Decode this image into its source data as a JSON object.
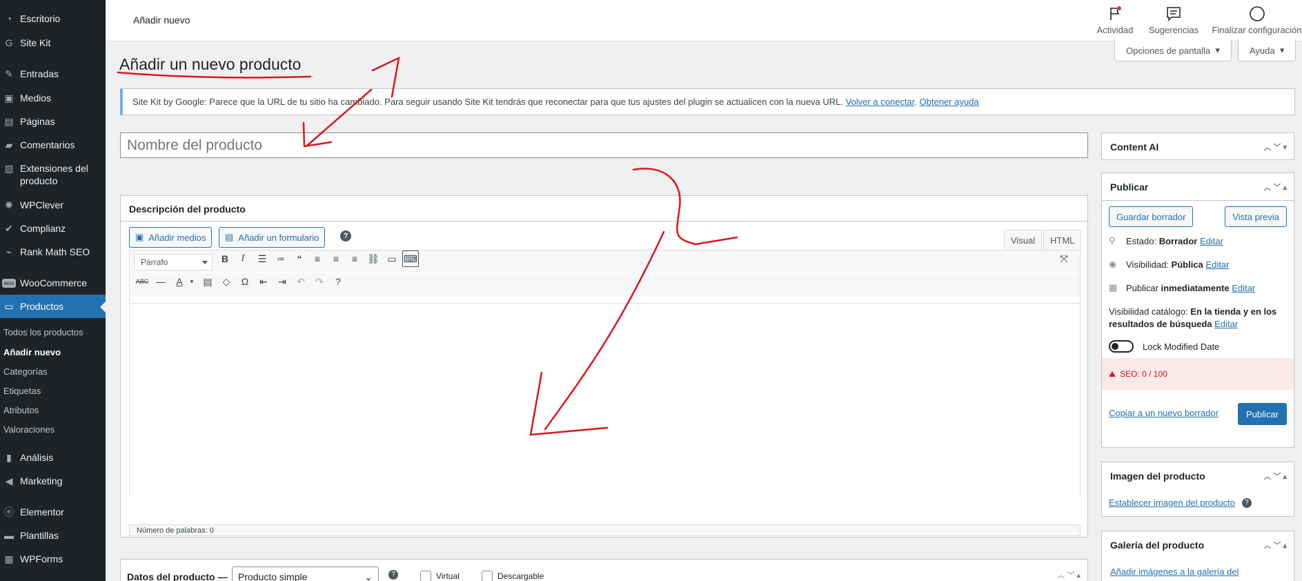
{
  "sidebar": {
    "items": [
      {
        "label": "Escritorio",
        "icon": "dashboard-icon"
      },
      {
        "label": "Site Kit",
        "icon": "sitekit-icon"
      },
      {
        "label": "Entradas",
        "icon": "pin-icon"
      },
      {
        "label": "Medios",
        "icon": "media-icon"
      },
      {
        "label": "Páginas",
        "icon": "page-icon"
      },
      {
        "label": "Comentarios",
        "icon": "comment-icon"
      },
      {
        "label": "Extensiones del producto",
        "icon": "extension-icon"
      },
      {
        "label": "WPClever",
        "icon": "bulb-icon"
      },
      {
        "label": "Complianz",
        "icon": "check-icon"
      },
      {
        "label": "Rank Math SEO",
        "icon": "chart-icon"
      },
      {
        "label": "WooCommerce",
        "icon": "woo-icon"
      },
      {
        "label": "Productos",
        "icon": "archive-icon"
      },
      {
        "label": "Análisis",
        "icon": "bar-chart-icon"
      },
      {
        "label": "Marketing",
        "icon": "megaphone-icon"
      },
      {
        "label": "Elementor",
        "icon": "elementor-icon"
      },
      {
        "label": "Plantillas",
        "icon": "folder-icon"
      },
      {
        "label": "WPForms",
        "icon": "forms-icon"
      }
    ],
    "subitems": [
      {
        "label": "Todos los productos"
      },
      {
        "label": "Añadir nuevo"
      },
      {
        "label": "Categorías"
      },
      {
        "label": "Etiquetas"
      },
      {
        "label": "Atributos"
      },
      {
        "label": "Valoraciones"
      }
    ]
  },
  "topbar": {
    "breadcrumb": "Añadir nuevo",
    "actions": [
      {
        "label": "Actividad",
        "icon": "flag-icon"
      },
      {
        "label": "Sugerencias",
        "icon": "message-icon"
      },
      {
        "label": "Finalizar configuración",
        "icon": "circle-icon"
      }
    ],
    "screen_options": "Opciones de pantalla",
    "help": "Ayuda"
  },
  "page": {
    "title": "Añadir un nuevo producto",
    "notice_text": "Site Kit by Google: Parece que la URL de tu sitio ha cambiado. Para seguir usando Site Kit tendrás que reconectar para que tus ajustes del plugin se actualicen con la nueva URL.",
    "notice_link1": "Volver a conectar",
    "notice_sep": ".",
    "notice_link2": "Obtener ayuda",
    "title_placeholder": "Nombre del producto"
  },
  "editor": {
    "header": "Descripción del producto",
    "add_media": "Añadir medios",
    "add_form": "Añadir un formulario",
    "tab_visual": "Visual",
    "tab_html": "HTML",
    "format": "Párrafo",
    "word_count": "Número de palabras: 0"
  },
  "product_data": {
    "title": "Datos del producto —",
    "type": "Producto simple",
    "virtual": "Virtual",
    "downloadable": "Descargable"
  },
  "content_ai": {
    "title": "Content AI"
  },
  "publish": {
    "title": "Publicar",
    "save_draft": "Guardar borrador",
    "preview": "Vista previa",
    "status_label": "Estado: ",
    "status_value": "Borrador",
    "edit": "Editar",
    "visibility_label": "Visibilidad: ",
    "visibility_value": "Pública",
    "publish_label": "Publicar ",
    "publish_value": "inmediatamente",
    "catalog_label": "Visibilidad catálogo: ",
    "catalog_value": "En la tienda y en los resultados de búsqueda",
    "lock_label": "Lock Modified Date",
    "seo": "SEO: 0 / 100",
    "copy_draft": "Copiar a un nuevo borrador",
    "publish_button": "Publicar"
  },
  "product_image": {
    "title": "Imagen del producto",
    "link": "Establecer imagen del producto"
  },
  "gallery": {
    "title": "Galería del producto",
    "link": "Añadir imágenes a la galería del"
  },
  "colors": {
    "sidebar": "#1d2327",
    "accent": "#2271b1",
    "annotation": "#d9161c"
  }
}
